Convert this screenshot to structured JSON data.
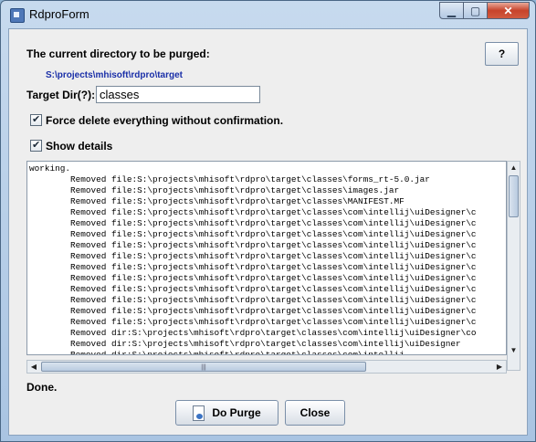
{
  "window": {
    "title": "RdproForm",
    "min_glyph": "▁",
    "max_glyph": "▢",
    "close_glyph": "✕"
  },
  "header": {
    "current_dir_label": "The current directory to be purged:",
    "current_dir_path": "S:\\projects\\mhisoft\\rdpro\\target",
    "help_label": "?"
  },
  "target": {
    "label": "Target Dir(?):",
    "value": "classes"
  },
  "options": {
    "force_delete_label": "Force delete everything without confirmation.",
    "force_delete_checked": true,
    "show_details_label": "Show details",
    "show_details_checked": true
  },
  "log": {
    "lines": [
      "working.",
      "        Removed file:S:\\projects\\mhisoft\\rdpro\\target\\classes\\forms_rt-5.0.jar",
      "        Removed file:S:\\projects\\mhisoft\\rdpro\\target\\classes\\images.jar",
      "        Removed file:S:\\projects\\mhisoft\\rdpro\\target\\classes\\MANIFEST.MF",
      "        Removed file:S:\\projects\\mhisoft\\rdpro\\target\\classes\\com\\intellij\\uiDesigner\\c",
      "        Removed file:S:\\projects\\mhisoft\\rdpro\\target\\classes\\com\\intellij\\uiDesigner\\c",
      "        Removed file:S:\\projects\\mhisoft\\rdpro\\target\\classes\\com\\intellij\\uiDesigner\\c",
      "        Removed file:S:\\projects\\mhisoft\\rdpro\\target\\classes\\com\\intellij\\uiDesigner\\c",
      "        Removed file:S:\\projects\\mhisoft\\rdpro\\target\\classes\\com\\intellij\\uiDesigner\\c",
      "        Removed file:S:\\projects\\mhisoft\\rdpro\\target\\classes\\com\\intellij\\uiDesigner\\c",
      "        Removed file:S:\\projects\\mhisoft\\rdpro\\target\\classes\\com\\intellij\\uiDesigner\\c",
      "        Removed file:S:\\projects\\mhisoft\\rdpro\\target\\classes\\com\\intellij\\uiDesigner\\c",
      "        Removed file:S:\\projects\\mhisoft\\rdpro\\target\\classes\\com\\intellij\\uiDesigner\\c",
      "        Removed file:S:\\projects\\mhisoft\\rdpro\\target\\classes\\com\\intellij\\uiDesigner\\c",
      "        Removed file:S:\\projects\\mhisoft\\rdpro\\target\\classes\\com\\intellij\\uiDesigner\\c",
      "        Removed dir:S:\\projects\\mhisoft\\rdpro\\target\\classes\\com\\intellij\\uiDesigner\\co",
      "        Removed dir:S:\\projects\\mhisoft\\rdpro\\target\\classes\\com\\intellij\\uiDesigner",
      "        Removed dir:S:\\projects\\mhisoft\\rdpro\\target\\classes\\com\\intellij"
    ]
  },
  "scroll": {
    "up": "▲",
    "down": "▼",
    "left": "◀",
    "right": "▶",
    "grip": "|||"
  },
  "status": {
    "text": "Done."
  },
  "buttons": {
    "purge_label": "Do Purge",
    "close_label": "Close"
  }
}
